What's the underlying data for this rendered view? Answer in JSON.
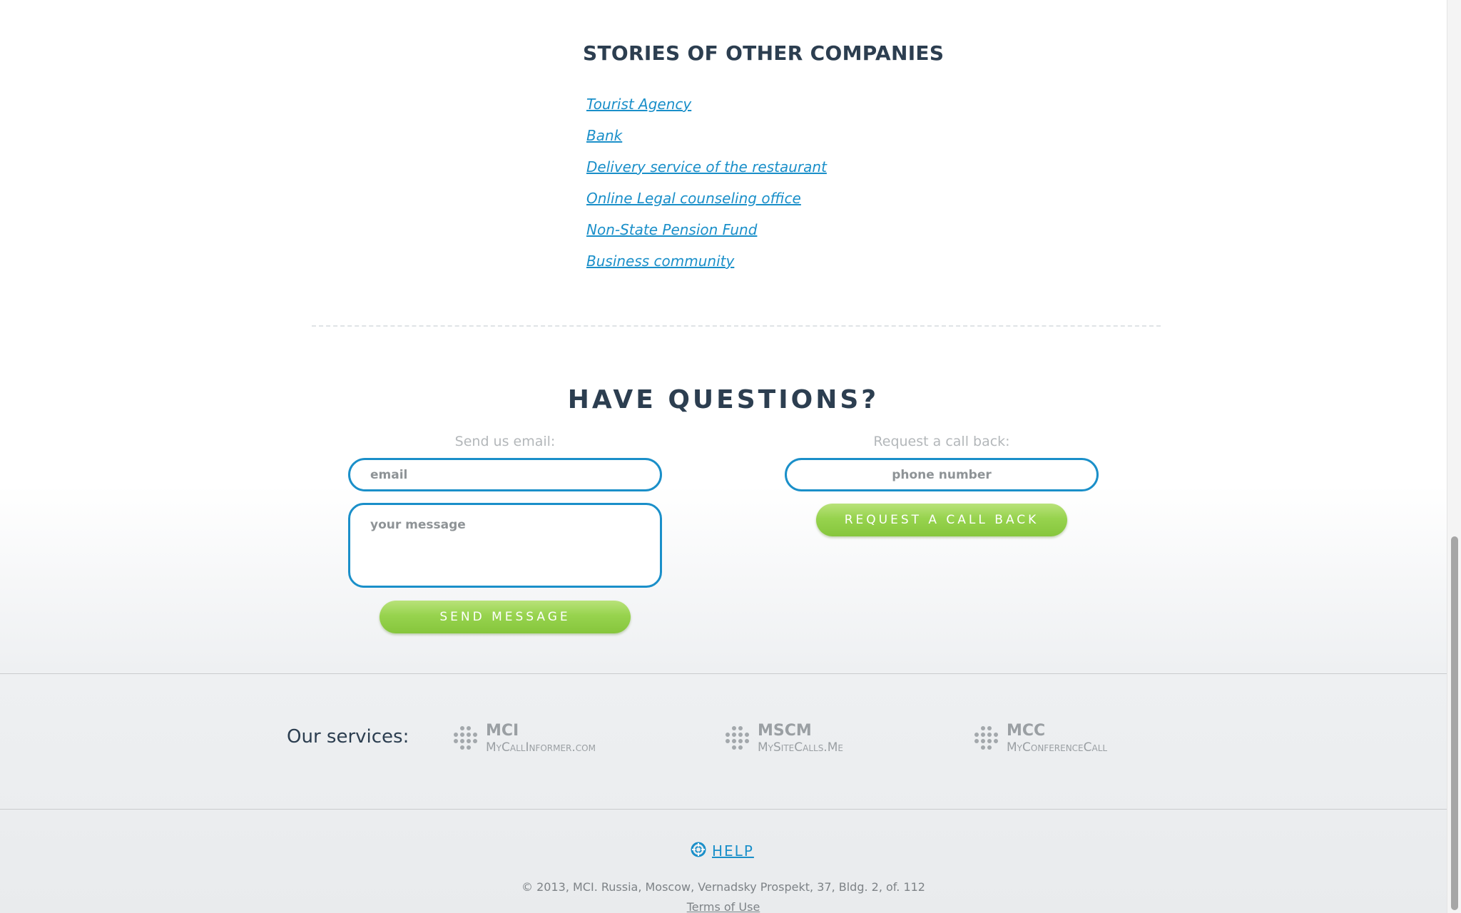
{
  "stories": {
    "title": "STORIES OF OTHER COMPANIES",
    "links": [
      "Tourist Agency",
      "Bank",
      "Delivery service of the restaurant",
      "Online Legal counseling office",
      "Non-State Pension Fund",
      "Business community"
    ]
  },
  "questions": {
    "title": "HAVE QUESTIONS?",
    "email_label": "Send us email:",
    "email_placeholder": "email",
    "message_placeholder": "your message",
    "send_button": "SEND MESSAGE",
    "call_label": "Request a call back:",
    "phone_placeholder": "phone number",
    "call_button": "REQUEST A CALL BACK"
  },
  "services": {
    "label": "Our services:",
    "items": [
      {
        "abbr": "MCI",
        "domain": "MyCallInformer.com",
        "icon": "dots-logo-icon"
      },
      {
        "abbr": "MSCM",
        "domain": "MySiteCalls.Me",
        "icon": "dots-logo-icon"
      },
      {
        "abbr": "MCC",
        "domain": "MyConferenceCall",
        "icon": "dots-logo-icon"
      }
    ]
  },
  "footer": {
    "help_label": "HELP",
    "help_icon": "lifebuoy-icon",
    "copyright": "© 2013, MCI. Russia, Moscow, Vernadsky Prospekt, 37, Bldg. 2, of. 112",
    "terms": "Terms of Use"
  },
  "colors": {
    "link": "#1a8fc9",
    "heading": "#2c3e50",
    "button_green": "#97d34e",
    "input_border": "#1a8fc9"
  }
}
